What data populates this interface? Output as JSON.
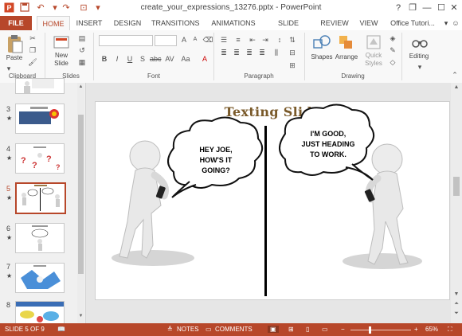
{
  "window": {
    "title": "create_your_expressions_13276.pptx - PowerPoint",
    "controls": {
      "help": "?",
      "restore": "❐",
      "minimize": "—",
      "maximize": "☐",
      "close": "✕"
    }
  },
  "tabs": {
    "file": "FILE",
    "home": "HOME",
    "insert": "INSERT",
    "design": "DESIGN",
    "transitions": "TRANSITIONS",
    "animations": "ANIMATIONS",
    "slideshow": "SLIDE SHOW",
    "review": "REVIEW",
    "view": "VIEW",
    "account": "Office Tutori..."
  },
  "ribbon": {
    "clipboard": {
      "paste": "Paste",
      "group": "Clipboard"
    },
    "slides": {
      "new_slide_line1": "New",
      "new_slide_line2": "Slide",
      "group": "Slides"
    },
    "font": {
      "group": "Font",
      "bold": "B",
      "italic": "I",
      "underline": "U",
      "strike": "S",
      "charspace": "AV",
      "case": "Aa",
      "color": "A",
      "grow": "A",
      "shrink": "A"
    },
    "paragraph": {
      "group": "Paragraph"
    },
    "drawing": {
      "shapes": "Shapes",
      "arrange": "Arrange",
      "quick_line1": "Quick",
      "quick_line2": "Styles",
      "group": "Drawing"
    },
    "editing": {
      "label": "Editing"
    }
  },
  "thumbnails": [
    {
      "number": "3",
      "star": "★",
      "selected": false
    },
    {
      "number": "4",
      "star": "★",
      "selected": false
    },
    {
      "number": "5",
      "star": "★",
      "selected": true
    },
    {
      "number": "6",
      "star": "★",
      "selected": false
    },
    {
      "number": "7",
      "star": "★",
      "selected": false
    },
    {
      "number": "8",
      "star": "",
      "selected": false
    }
  ],
  "slide": {
    "title": "Texting Slide",
    "left_bubble": {
      "line1": "HEY JOE,",
      "line2": "HOW'S IT",
      "line3": "GOING?"
    },
    "right_bubble": {
      "line1": "I'M GOOD,",
      "line2": "JUST HEADING",
      "line3": "TO WORK."
    }
  },
  "status": {
    "slide_info": "SLIDE 5 OF 9",
    "notes": "NOTES",
    "comments": "COMMENTS",
    "zoom": "65%",
    "zoom_minus": "−",
    "zoom_plus": "+",
    "zoom_level": 0.65
  },
  "colors": {
    "accent": "#b7472a"
  }
}
